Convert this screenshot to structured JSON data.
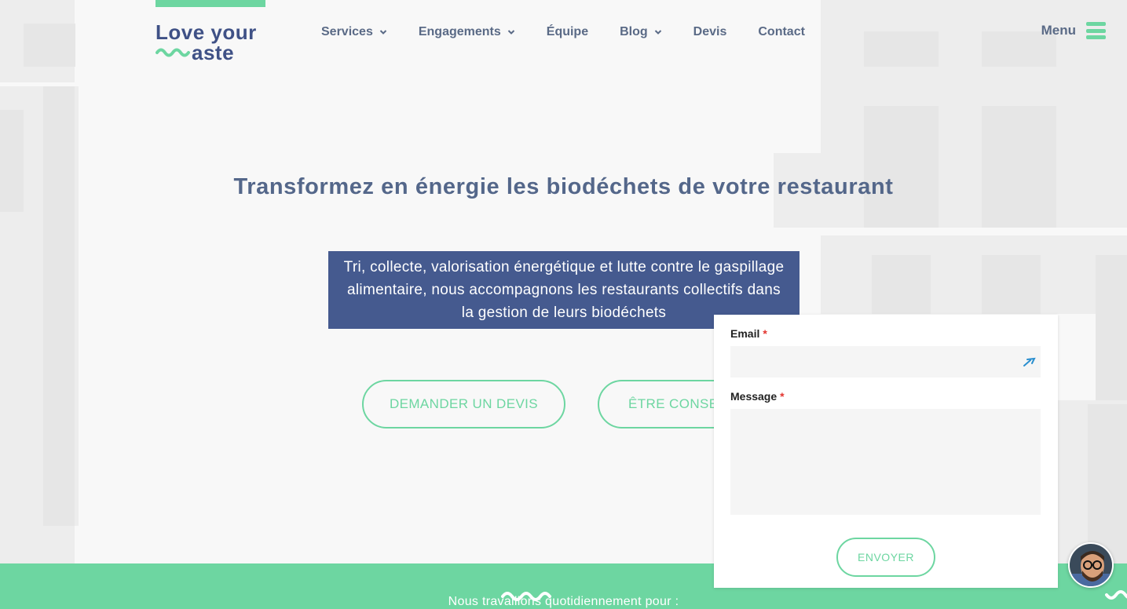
{
  "colors": {
    "brand_blue": "#3f5186",
    "hero_box": "#455a8f",
    "accent_green": "#6dd6a1",
    "nav_text": "#5a6a86"
  },
  "header": {
    "logo_line1": "Love your",
    "logo_line2": "aste",
    "nav": [
      {
        "label": "Services",
        "dropdown": true
      },
      {
        "label": "Engagements",
        "dropdown": true
      },
      {
        "label": "Équipe",
        "dropdown": false
      },
      {
        "label": "Blog",
        "dropdown": true
      },
      {
        "label": "Devis",
        "dropdown": false
      },
      {
        "label": "Contact",
        "dropdown": false
      }
    ],
    "menu_label": "Menu",
    "menu_icon": "hamburger-icon"
  },
  "hero": {
    "title": "Transformez en énergie les biodéchets de votre restaurant",
    "subtitle": "Tri, collecte, valorisation énergétique et lutte contre le gaspillage alimentaire, nous accompagnons les restaurants collectifs dans la gestion de leurs biodéchets",
    "cta_devis": "DEMANDER UN DEVIS",
    "cta_conseil": "ÊTRE CONSEILLÉ"
  },
  "band": {
    "text": "Nous travaillons quotidiennement pour :"
  },
  "contact_form": {
    "email_label": "Email",
    "email_value": "",
    "message_label": "Message",
    "message_value": "",
    "required_mark": "*",
    "submit_label": "ENVOYER"
  }
}
